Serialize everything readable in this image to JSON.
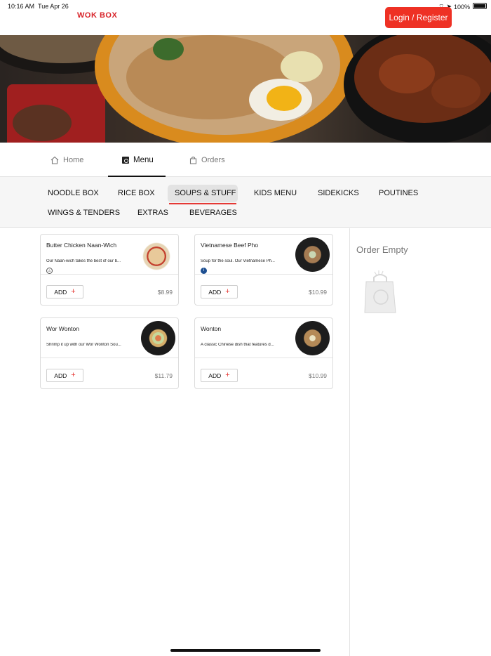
{
  "status_bar": {
    "time": "10:16 AM",
    "date": "Tue Apr 26",
    "battery": "100%"
  },
  "header": {
    "logo_text": "WOK BOX",
    "login_label": "Login / Register",
    "accent_color": "#ee3124"
  },
  "nav": {
    "home": "Home",
    "menu": "Menu",
    "orders": "Orders"
  },
  "categories": [
    "NOODLE BOX",
    "RICE BOX",
    "SOUPS & STUFF",
    "KIDS MENU",
    "SIDEKICKS",
    "POUTINES",
    "WINGS & TENDERS",
    "EXTRAS",
    "BEVERAGES"
  ],
  "active_category": "SOUPS & STUFF",
  "products": [
    {
      "name": "Butter Chicken Naan-Wich",
      "desc": "Our Naan-wich takes the best of our b...",
      "price": "$8.99",
      "add": "ADD",
      "badge": "chili-icon"
    },
    {
      "name": "Vietnamese Beef Pho",
      "desc": "Soup for the soul. Our Vietnamese Ph...",
      "price": "$10.99",
      "add": "ADD",
      "badge": "info-icon"
    },
    {
      "name": "Wor Wonton",
      "desc": "Shrimp it up with our Wor Wonton Sou...",
      "price": "$11.79",
      "add": "ADD"
    },
    {
      "name": "Wonton",
      "desc": "A classic Chinese dish that features d...",
      "price": "$10.99",
      "add": "ADD"
    }
  ],
  "order": {
    "title": "Order Empty"
  }
}
